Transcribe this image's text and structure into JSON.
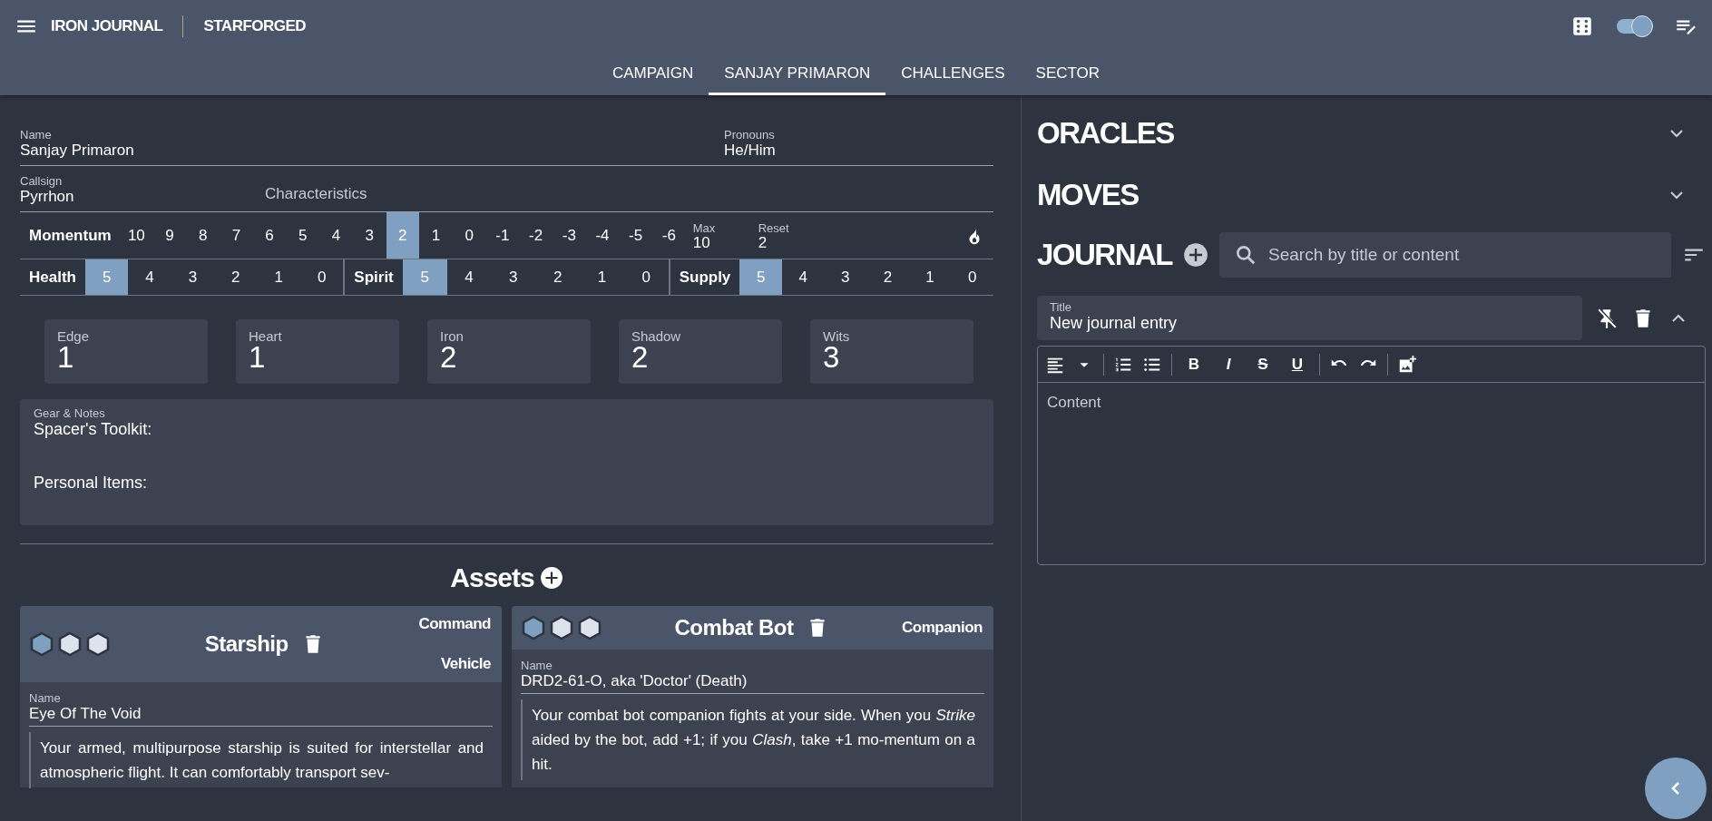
{
  "app_bar": {
    "title": "IRON JOURNAL",
    "subtitle": "STARFORGED",
    "dark_mode": {
      "on": true
    }
  },
  "tabs": [
    {
      "label": "CAMPAIGN",
      "selected": false
    },
    {
      "label": "SANJAY PRIMARON",
      "selected": true
    },
    {
      "label": "CHALLENGES",
      "selected": false
    },
    {
      "label": "SECTOR",
      "selected": false
    }
  ],
  "character": {
    "name": {
      "label": "Name",
      "value": "Sanjay Primaron"
    },
    "pronouns": {
      "label": "Pronouns",
      "value": "He/Him"
    },
    "callsign": {
      "label": "Callsign",
      "value": "Pyrrhon"
    },
    "characteristics": {
      "placeholder": "Characteristics"
    }
  },
  "momentum": {
    "label": "Momentum",
    "values": [
      {
        "value": "10",
        "selected": false
      },
      {
        "value": "9",
        "selected": false
      },
      {
        "value": "8",
        "selected": false
      },
      {
        "value": "7",
        "selected": false
      },
      {
        "value": "6",
        "selected": false
      },
      {
        "value": "5",
        "selected": false
      },
      {
        "value": "4",
        "selected": false
      },
      {
        "value": "3",
        "selected": false
      },
      {
        "value": "2",
        "selected": true
      },
      {
        "value": "1",
        "selected": false
      },
      {
        "value": "0",
        "selected": false
      },
      {
        "value": "-1",
        "selected": false
      },
      {
        "value": "-2",
        "selected": false
      },
      {
        "value": "-3",
        "selected": false
      },
      {
        "value": "-4",
        "selected": false
      },
      {
        "value": "-5",
        "selected": false
      },
      {
        "value": "-6",
        "selected": false
      }
    ],
    "max": {
      "label": "Max",
      "value": "10"
    },
    "reset": {
      "label": "Reset",
      "value": "2"
    }
  },
  "meters": [
    {
      "label": "Health",
      "values": [
        {
          "value": "5",
          "selected": true
        },
        {
          "value": "4",
          "selected": false
        },
        {
          "value": "3",
          "selected": false
        },
        {
          "value": "2",
          "selected": false
        },
        {
          "value": "1",
          "selected": false
        },
        {
          "value": "0",
          "selected": false
        }
      ]
    },
    {
      "label": "Spirit",
      "values": [
        {
          "value": "5",
          "selected": true
        },
        {
          "value": "4",
          "selected": false
        },
        {
          "value": "3",
          "selected": false
        },
        {
          "value": "2",
          "selected": false
        },
        {
          "value": "1",
          "selected": false
        },
        {
          "value": "0",
          "selected": false
        }
      ]
    },
    {
      "label": "Supply",
      "values": [
        {
          "value": "5",
          "selected": true
        },
        {
          "value": "4",
          "selected": false
        },
        {
          "value": "3",
          "selected": false
        },
        {
          "value": "2",
          "selected": false
        },
        {
          "value": "1",
          "selected": false
        },
        {
          "value": "0",
          "selected": false
        }
      ]
    }
  ],
  "stats": [
    {
      "label": "Edge",
      "value": "1"
    },
    {
      "label": "Heart",
      "value": "1"
    },
    {
      "label": "Iron",
      "value": "2"
    },
    {
      "label": "Shadow",
      "value": "2"
    },
    {
      "label": "Wits",
      "value": "3"
    }
  ],
  "notes": {
    "label": "Gear & Notes",
    "lines": [
      "Spacer's Toolkit:",
      "Personal Items:"
    ]
  },
  "assets": {
    "title": "Assets",
    "items": [
      {
        "title": "Starship",
        "types": [
          "Command",
          "Vehicle"
        ],
        "abilities": [
          {
            "checked": true
          },
          {
            "checked": false
          },
          {
            "checked": false
          }
        ],
        "name_field": {
          "label": "Name",
          "value": "Eye Of The Void"
        },
        "description": "Your armed, multipurpose starship is suited for interstellar and atmospheric flight. It can comfortably transport sev-"
      },
      {
        "title": "Combat Bot",
        "types": [
          "Companion"
        ],
        "abilities": [
          {
            "checked": true
          },
          {
            "checked": false
          },
          {
            "checked": false
          }
        ],
        "name_field": {
          "label": "Name",
          "value": "DRD2-61-O, aka 'Doctor' (Death)"
        },
        "description": "Your combat bot companion fights at your side. When you *Strike* aided by the bot, add +1; if you *Clash*, take +1 mo-mentum on a hit."
      }
    ]
  },
  "sidebar": {
    "sections": [
      {
        "title": "ORACLES",
        "expanded": false
      },
      {
        "title": "MOVES",
        "expanded": false
      }
    ],
    "journal": {
      "title": "JOURNAL",
      "search": {
        "placeholder": "Search by title or content"
      },
      "entry": {
        "title_label": "Title",
        "title_value": "New journal entry",
        "expanded": true,
        "format_buttons": [
          "B",
          "I",
          "S",
          "U"
        ],
        "content_placeholder": "Content"
      }
    }
  }
}
